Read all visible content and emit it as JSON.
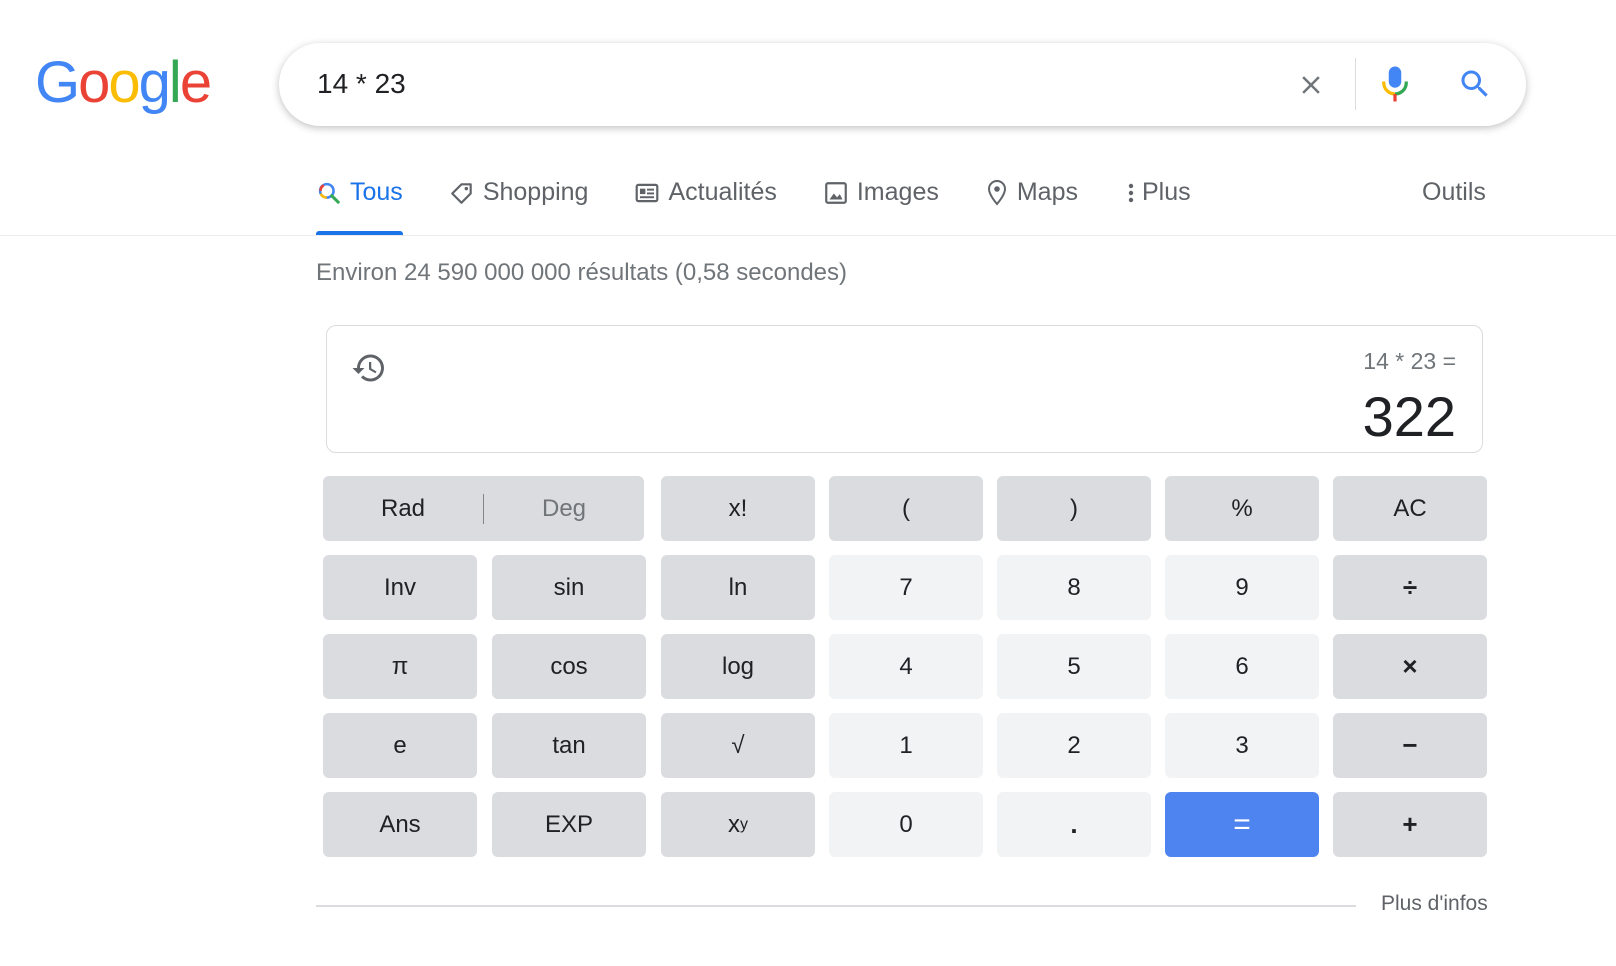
{
  "logo": {
    "letters": [
      "G",
      "o",
      "o",
      "g",
      "l",
      "e"
    ],
    "colors": [
      "#4285F4",
      "#EA4335",
      "#FBBC05",
      "#4285F4",
      "#34A853",
      "#EA4335"
    ]
  },
  "search": {
    "query": "14 * 23",
    "clear_icon": "close-icon",
    "mic_icon": "mic-icon",
    "search_icon": "search-icon"
  },
  "tabs": [
    {
      "label": "Tous",
      "icon": "search-icon",
      "active": true
    },
    {
      "label": "Shopping",
      "icon": "tag-icon"
    },
    {
      "label": "Actualités",
      "icon": "newspaper-icon"
    },
    {
      "label": "Images",
      "icon": "image-icon"
    },
    {
      "label": "Maps",
      "icon": "map-pin-icon"
    },
    {
      "label": "Plus",
      "icon": "more-vert-icon"
    }
  ],
  "tools_label": "Outils",
  "result_stats": "Environ 24 590 000 000 résultats (0,58 secondes)",
  "calculator": {
    "expression": "14 * 23 =",
    "result": "322",
    "history_icon": "history-icon",
    "rad_label": "Rad",
    "deg_label": "Deg",
    "keys": {
      "factorial": "x!",
      "open_paren": "(",
      "close_paren": ")",
      "percent": "%",
      "clear": "AC",
      "inv": "Inv",
      "sin": "sin",
      "ln": "ln",
      "seven": "7",
      "eight": "8",
      "nine": "9",
      "divide": "÷",
      "pi": "π",
      "cos": "cos",
      "log": "log",
      "four": "4",
      "five": "5",
      "six": "6",
      "multiply": "×",
      "e": "e",
      "tan": "tan",
      "sqrt": "√",
      "one": "1",
      "two": "2",
      "three": "3",
      "minus": "−",
      "ans": "Ans",
      "exp": "EXP",
      "power_base": "x",
      "power_exp": "y",
      "zero": "0",
      "decimal": ".",
      "equals": "=",
      "plus": "+"
    }
  },
  "more_info": "Plus d'infos",
  "colors": {
    "accent": "#1a73e8",
    "equals_key": "#4d84f0",
    "fn_key": "#dadce0",
    "num_key": "#f1f3f4"
  }
}
